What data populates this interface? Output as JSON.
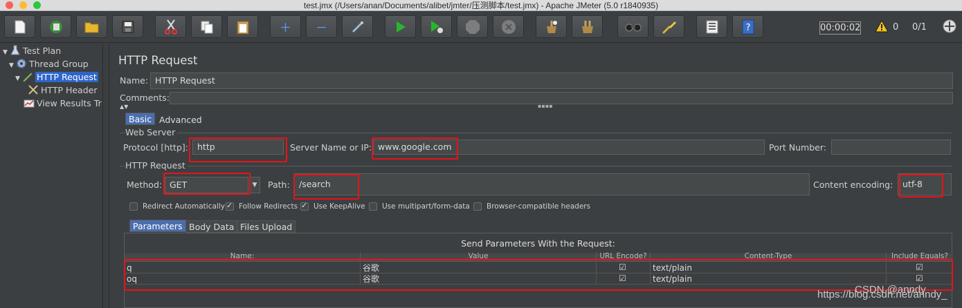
{
  "window": {
    "title": "test.jmx (/Users/anan/Documents/alibet/jmter/压测脚本/test.jmx) - Apache JMeter (5.0 r1840935)",
    "traffic_light_colors": [
      "#fd5f57",
      "#febb2e",
      "#28c840"
    ]
  },
  "toolbar": {
    "buttons": [
      {
        "name": "new-icon"
      },
      {
        "name": "templates-icon"
      },
      {
        "name": "open-icon"
      },
      {
        "name": "save-icon"
      },
      {
        "name": "cut-icon"
      },
      {
        "name": "copy-icon"
      },
      {
        "name": "paste-icon"
      },
      {
        "name": "expand-icon"
      },
      {
        "name": "collapse-icon"
      },
      {
        "name": "toggle-icon"
      },
      {
        "name": "start-icon"
      },
      {
        "name": "start-no-pauses-icon"
      },
      {
        "name": "stop-icon"
      },
      {
        "name": "shutdown-icon"
      },
      {
        "name": "clear-icon"
      },
      {
        "name": "clear-all-icon"
      },
      {
        "name": "search-icon"
      },
      {
        "name": "reset-search-icon"
      },
      {
        "name": "function-helper-icon"
      },
      {
        "name": "help-icon"
      }
    ],
    "timer": "00:00:02",
    "warning_count": "0",
    "threads": "0/1"
  },
  "tree": {
    "items": [
      {
        "label": "Test Plan",
        "icon": "flask-icon"
      },
      {
        "label": "Thread Group",
        "icon": "gear-icon"
      },
      {
        "label": "HTTP Request",
        "icon": "pencil-icon",
        "selected": true
      },
      {
        "label": "HTTP Header",
        "icon": "wrench-icon"
      },
      {
        "label": "View Results Tr",
        "icon": "chart-icon"
      }
    ]
  },
  "panel": {
    "title": "HTTP Request",
    "name_label": "Name:",
    "name_value": "HTTP Request",
    "comments_label": "Comments:",
    "tabs": [
      "Basic",
      "Advanced"
    ],
    "web_server": {
      "title": "Web Server",
      "protocol_label": "Protocol [http]:",
      "protocol_value": "http",
      "server_label": "Server Name or IP:",
      "server_value": "www.google.com",
      "port_label": "Port Number:",
      "port_value": ""
    },
    "http_request": {
      "title": "HTTP Request",
      "method_label": "Method:",
      "method_value": "GET",
      "path_label": "Path:",
      "path_value": "/search",
      "encoding_label": "Content encoding:",
      "encoding_value": "utf-8"
    },
    "options": [
      {
        "label": "Redirect Automatically",
        "checked": false
      },
      {
        "label": "Follow Redirects",
        "checked": true
      },
      {
        "label": "Use KeepAlive",
        "checked": true
      },
      {
        "label": "Use multipart/form-data",
        "checked": false
      },
      {
        "label": "Browser-compatible headers",
        "checked": false
      }
    ],
    "param_tabs": [
      "Parameters",
      "Body Data",
      "Files Upload"
    ],
    "params_title": "Send Parameters With the Request:",
    "columns": [
      "Name:",
      "Value",
      "URL Encode?",
      "Content-Type",
      "Include Equals?"
    ],
    "rows": [
      {
        "name": "q",
        "value": "谷歌",
        "url_encode": true,
        "content_type": "text/plain",
        "include_equals": true
      },
      {
        "name": "oq",
        "value": "谷歌",
        "url_encode": true,
        "content_type": "text/plain",
        "include_equals": true
      }
    ]
  },
  "watermark": {
    "line1": "CSDN @anndy",
    "line2": "https://blog.csdn.net/anndy_"
  },
  "colors": {
    "highlight": "#e8131a",
    "selection": "#2f65ca",
    "tab_active": "#4b6eaf"
  }
}
